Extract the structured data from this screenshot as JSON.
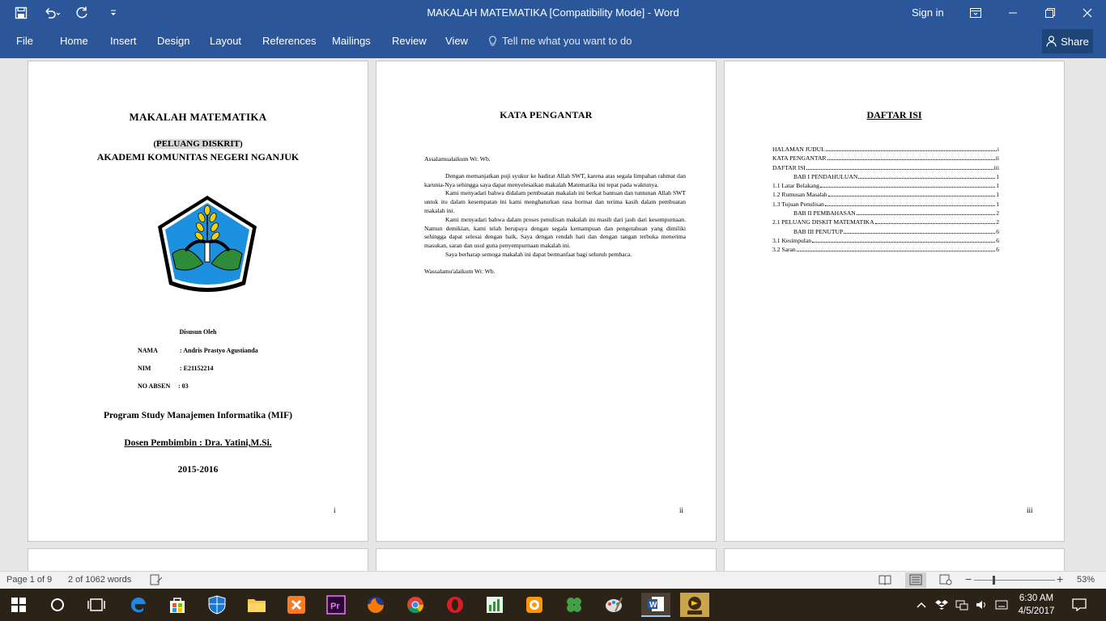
{
  "window": {
    "title": "MAKALAH  MATEMATIKA [Compatibility Mode]  -  Word",
    "signin": "Sign in"
  },
  "ribbon": {
    "tabs": [
      "File",
      "Home",
      "Insert",
      "Design",
      "Layout",
      "References",
      "Mailings",
      "Review",
      "View"
    ],
    "tell_me": "Tell me what you want to do",
    "share": "Share"
  },
  "page1": {
    "title": "MAKALAH  MATEMATIKA",
    "subtitle_open": "(",
    "subtitle": "PELUANG DISKRIT",
    "subtitle_close": ")",
    "institution": "AKADEMI KOMUNITAS NEGERI NGANJUK",
    "disusun": "Disusun Oleh",
    "nama_label": "NAMA",
    "nama_value": ": Andris Prastyo Agustianda",
    "nim_label": "NIM",
    "nim_value": ": E21152214",
    "absen_label": "NO ABSEN",
    "absen_value": ":  03",
    "program": "Program Study Manajemen Informatika (MIF)",
    "dosen": "Dosen Pembimbin : Dra. Yatini,M.Si.",
    "year": "2015-2016",
    "page_number": "i"
  },
  "page2": {
    "title": "KATA PENGANTAR",
    "greeting": "Assalamualaikum Wr. Wb.",
    "para1": "Dengan memanjatkan puji syukur ke hadirat Allah SWT, karena atas segala limpahan rahmat dan karunia-Nya sehingga saya dapat menyelesaikan makalah Matematika ini tepat pada waktunya.",
    "para2": "Kami menyadari bahwa didalam pembuatan makalah ini berkat bantuan dan tuntunan Allah SWT untuk itu dalam kesempatan ini kami menghaturkan rasa hormat dan terima kasih dalam pembuatan makalah ini.",
    "para3": "Kami menyadari bahwa dalam proses penulisan makalah ini masih dari jauh dari kesempurnaan. Namun demikian, kami telah berupaya dengan segala kemampuan dan pengetahuan yang dimiliki sehingga dapat selesai dengan baik, Saya dengan rendah hati dan dengan tangan terbuka menerima masukan, saran dan usul guna penyempurnaan makalah ini.",
    "para4": "Saya berharap semoga makalah ini dapat bermanfaat bagi seluruh pembaca.",
    "closing": "Wassalamu'alaikum Wr. Wb.",
    "page_number": "ii"
  },
  "page3": {
    "title": "DAFTAR ISI",
    "toc": [
      {
        "text": "HALAMAN JUDUL",
        "page": "i"
      },
      {
        "text": "KATA PENGANTAR",
        "page": "ii"
      },
      {
        "text": "DAFTAR ISI",
        "page": "iii"
      },
      {
        "text": "BAB I PENDAHULUAN",
        "page": "1"
      },
      {
        "text": "1.1  Latar Belakang",
        "page": "1"
      },
      {
        "text": "1.2  Rumusan Masalah",
        "page": "1"
      },
      {
        "text": "1.3  Tujuan Penulisan",
        "page": "1"
      },
      {
        "text": "BAB II PEMBAHASAN",
        "page": "2"
      },
      {
        "text": "2.1 PELUANG DISKIT MATEMATIKA",
        "page": "2"
      },
      {
        "text": "BAB III PENUTUP",
        "page": "6"
      },
      {
        "text": "3.1 Kesimpulan",
        "page": "6"
      },
      {
        "text": "3.2 Saran",
        "page": "6"
      }
    ],
    "page_number": "iii"
  },
  "statusbar": {
    "page": "Page 1 of 9",
    "words": "2 of 1062 words",
    "zoom": "53%"
  },
  "taskbar": {
    "time": "6:30 AM",
    "date": "4/5/2017"
  },
  "colors": {
    "word_blue": "#2b579a",
    "share_bg": "#1f4478",
    "logo_blue": "#1e90e0",
    "logo_yellow": "#f5d000",
    "logo_green": "#2e8b3a"
  }
}
